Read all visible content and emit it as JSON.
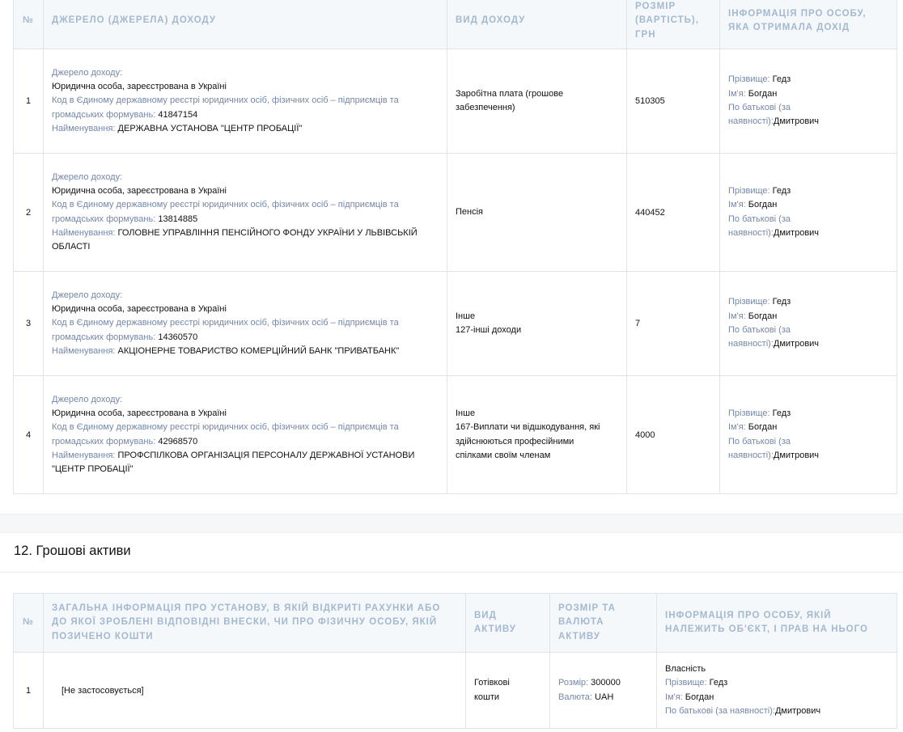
{
  "income": {
    "headers": {
      "num": "№",
      "source": "ДЖЕРЕЛО (ДЖЕРЕЛА) ДОХОДУ",
      "type": "ВИД ДОХОДУ",
      "amount": "РОЗМІР (ВАРТІСТЬ), ГРН",
      "person": "ІНФОРМАЦІЯ ПРО ОСОБУ, ЯКА ОТРИМАЛА ДОХІД"
    },
    "labels": {
      "source": "Джерело доходу:",
      "code": "Код в Єдиному державному реєстрі юридичних осіб, фізичних осіб – підприємців та громадських формувань:",
      "name": "Найменування:",
      "surname": "Прізвище:",
      "firstname": "Ім'я:",
      "patronymic": "По батькові (за наявності):"
    },
    "rows": [
      {
        "num": "1",
        "entity": "Юридична особа, зареєстрована в Україні",
        "code": "41847154",
        "name": "ДЕРЖАВНА УСТАНОВА \"ЦЕНТР ПРОБАЦІЇ\"",
        "type": [
          "Заробітна плата (грошове",
          "забезпечення)"
        ],
        "amount": "510305",
        "surname": "Гедз",
        "firstname": "Богдан",
        "patronymic": "Дмитрович"
      },
      {
        "num": "2",
        "entity": "Юридична особа, зареєстрована в Україні",
        "code": "13814885",
        "name": "ГОЛОВНЕ УПРАВЛІННЯ ПЕНСІЙНОГО ФОНДУ УКРАЇНИ У ЛЬВІВСЬКІЙ ОБЛАСТІ",
        "type": [
          "Пенсія"
        ],
        "amount": "440452",
        "surname": "Гедз",
        "firstname": "Богдан",
        "patronymic": "Дмитрович"
      },
      {
        "num": "3",
        "entity": "Юридична особа, зареєстрована в Україні",
        "code": "14360570",
        "name": "АКЦІОНЕРНЕ ТОВАРИСТВО КОМЕРЦІЙНИЙ БАНК \"ПРИВАТБАНК\"",
        "type": [
          "Інше",
          "127-інші доходи"
        ],
        "amount": "7",
        "surname": "Гедз",
        "firstname": "Богдан",
        "patronymic": "Дмитрович"
      },
      {
        "num": "4",
        "entity": "Юридична особа, зареєстрована в Україні",
        "code": "42968570",
        "name": "ПРОФСПІЛКОВА ОРГАНІЗАЦІЯ ПЕРСОНАЛУ ДЕРЖАВНОЇ УСТАНОВИ \"ЦЕНТР ПРОБАЦІЇ\"",
        "type": [
          "Інше",
          "167-Виплати чи відшкодування, які",
          "здійснюються професійними",
          "спілками своїм членам"
        ],
        "amount": "4000",
        "surname": "Гедз",
        "firstname": "Богдан",
        "patronymic": "Дмитрович"
      }
    ]
  },
  "assets_section": {
    "title": "12. Грошові активи",
    "headers": {
      "num": "№",
      "institution": "ЗАГАЛЬНА ІНФОРМАЦІЯ ПРО УСТАНОВУ, В ЯКІЙ ВІДКРИТІ РАХУНКИ АБО ДО ЯКОЇ ЗРОБЛЕНІ ВІДПОВІДНІ ВНЕСКИ, ЧИ ПРО ФІЗИЧНУ ОСОБУ, ЯКІЙ ПОЗИЧЕНО КОШТИ",
      "asset_type": "ВИД АКТИВУ",
      "amount_currency": "РОЗМІР ТА ВАЛЮТА АКТИВУ",
      "owner": "ІНФОРМАЦІЯ ПРО ОСОБУ, ЯКІЙ НАЛЕЖИТЬ ОБ'ЄКТ, І ПРАВ НА НЬОГО"
    },
    "labels": {
      "size": "Розмір:",
      "currency": "Валюта:",
      "surname": "Прізвище:",
      "firstname": "Ім'я:",
      "patronymic": "По батькові (за наявності):"
    },
    "rows": [
      {
        "num": "1",
        "institution": "[Не застосовується]",
        "asset_type": [
          "Готівкові",
          "кошти"
        ],
        "size": "300000",
        "currency": "UAH",
        "right": "Власність",
        "surname": "Гедз",
        "firstname": "Богдан",
        "patronymic": "Дмитрович"
      }
    ]
  }
}
